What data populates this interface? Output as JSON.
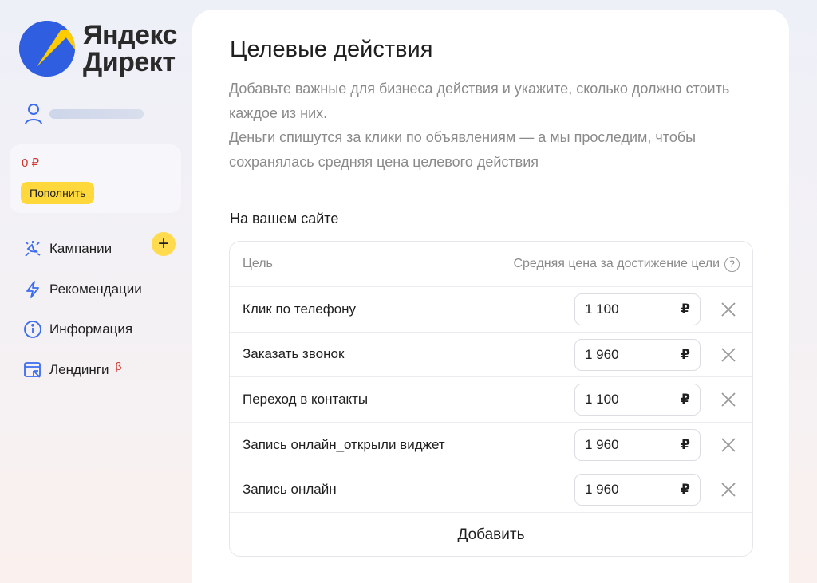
{
  "brand": {
    "line1": "Яндекс",
    "line2": "Директ"
  },
  "balance": {
    "amount": "0 ₽",
    "topup_label": "Пополнить"
  },
  "sidebar": {
    "items": [
      {
        "label": "Кампании",
        "icon": "campaigns-sparkle-icon"
      },
      {
        "label": "Рекомендации",
        "icon": "lightning-icon"
      },
      {
        "label": "Информация",
        "icon": "info-icon"
      },
      {
        "label": "Лендинги",
        "icon": "landing-icon",
        "badge": "β"
      }
    ]
  },
  "main": {
    "title": "Целевые действия",
    "description": [
      "Добавьте важные для бизнеса действия и укажите, сколько должно стоить каждое из них.",
      "Деньги спишутся за клики по объявлениям — а мы проследим, чтобы сохранялась средняя цена целевого действия"
    ],
    "section_title": "На вашем сайте",
    "table": {
      "col_goal": "Цель",
      "col_price": "Средняя цена за достижение цели",
      "help_symbol": "?",
      "currency": "₽",
      "rows": [
        {
          "goal": "Клик по телефону",
          "price": "1 100"
        },
        {
          "goal": "Заказать звонок",
          "price": "1 960"
        },
        {
          "goal": "Переход в контакты",
          "price": "1 100"
        },
        {
          "goal": "Запись онлайн_открыли виджет",
          "price": "1 960"
        },
        {
          "goal": "Запись онлайн",
          "price": "1 960"
        }
      ],
      "add_label": "Добавить"
    }
  },
  "colors": {
    "accent_yellow": "#ffdb4d",
    "brand_blue": "#2f5fe0",
    "alert_red": "#d0342c"
  }
}
